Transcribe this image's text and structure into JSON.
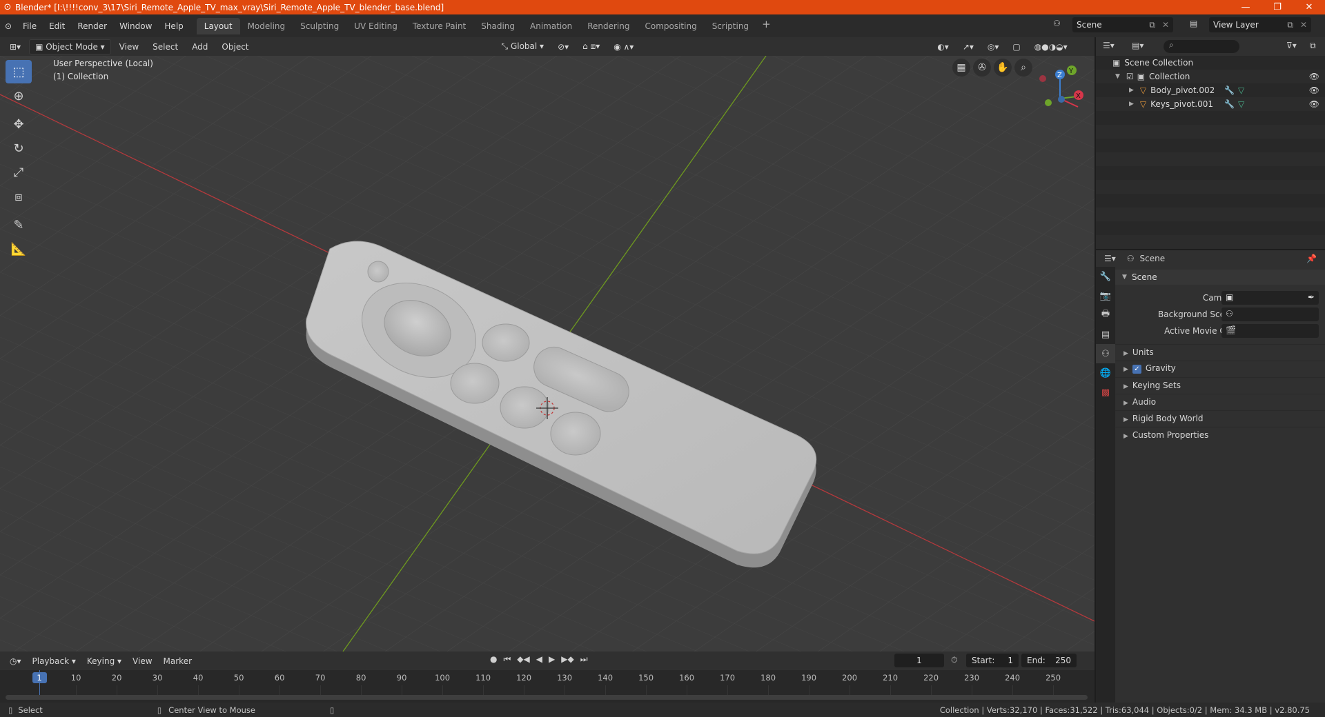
{
  "window": {
    "title": "Blender* [I:\\!!!!conv_3\\17\\Siri_Remote_Apple_TV_max_vray\\Siri_Remote_Apple_TV_blender_base.blend]",
    "minimize": "—",
    "maximize": "❐",
    "close": "✕"
  },
  "menu": [
    "File",
    "Edit",
    "Render",
    "Window",
    "Help"
  ],
  "workspaces": [
    "Layout",
    "Modeling",
    "Sculpting",
    "UV Editing",
    "Texture Paint",
    "Shading",
    "Animation",
    "Rendering",
    "Compositing",
    "Scripting"
  ],
  "active_workspace": "Layout",
  "scene_name": "Scene",
  "view_layer": "View Layer",
  "viewport": {
    "mode": "Object Mode",
    "menus": [
      "View",
      "Select",
      "Add",
      "Object"
    ],
    "transform_orientation": "Global",
    "info_line1": "User Perspective (Local)",
    "info_line2": "(1) Collection",
    "gizmo_axes": [
      "Z",
      "Y",
      "X"
    ]
  },
  "timeline": {
    "menus": [
      "Playback",
      "Keying",
      "View",
      "Marker"
    ],
    "current_frame": "1",
    "start_label": "Start:",
    "start": "1",
    "end_label": "End:",
    "end": "250",
    "ticks": [
      "1",
      "10",
      "20",
      "30",
      "40",
      "50",
      "60",
      "70",
      "80",
      "90",
      "100",
      "110",
      "120",
      "130",
      "140",
      "150",
      "160",
      "170",
      "180",
      "190",
      "200",
      "210",
      "220",
      "230",
      "240",
      "250"
    ]
  },
  "outliner": {
    "root": "Scene Collection",
    "collection": "Collection",
    "objects": [
      "Body_pivot.002",
      "Keys_pivot.001"
    ]
  },
  "properties": {
    "header": "Scene",
    "panel": "Scene",
    "camera_label": "Camera",
    "background_scene_label": "Background Scene",
    "active_movie_clip_label": "Active Movie Clip",
    "subpanels": [
      "Units",
      "Gravity",
      "Keying Sets",
      "Audio",
      "Rigid Body World",
      "Custom Properties"
    ]
  },
  "status": {
    "left_action": "Select",
    "middle_action": "Center View to Mouse",
    "stats": "Collection | Verts:32,170 | Faces:31,522 | Tris:63,044 | Objects:0/2 | Mem: 34.3 MB | v2.80.75"
  }
}
